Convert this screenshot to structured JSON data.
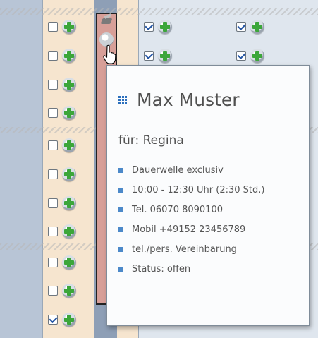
{
  "calendar": {
    "rows": [
      {
        "col1_checked": false,
        "col4_checked": true,
        "col5_checked": true
      },
      {
        "col1_checked": false,
        "col4_checked": true,
        "col5_checked": true
      },
      {
        "col1_checked": false
      },
      {
        "col1_checked": false
      },
      {
        "col1_checked": false
      },
      {
        "col1_checked": false
      },
      {
        "col1_checked": false
      },
      {
        "col1_checked": false
      },
      {
        "col1_checked": false
      },
      {
        "col1_checked": false
      },
      {
        "col1_checked": true
      }
    ]
  },
  "tooltip": {
    "name": "Max Muster",
    "for_label": "für: Regina",
    "details": [
      "Dauerwelle exclusiv",
      "10:00 - 12:30 Uhr (2:30 Std.)",
      "Tel. 06070 8090100",
      "Mobil +49152 23456789",
      "tel./pers. Vereinbarung",
      "Status: offen"
    ]
  },
  "colors": {
    "appointment": "#d79f98",
    "slot_free": "#f6e5cf",
    "accent": "#4c89c9"
  }
}
